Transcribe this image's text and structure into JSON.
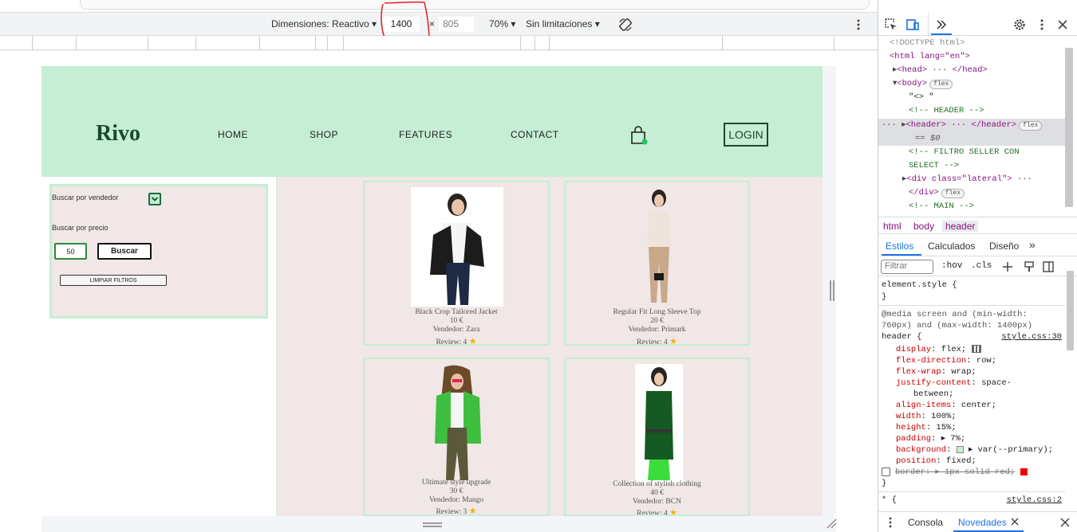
{
  "device_toolbar": {
    "dimensions_label": "Dimensiones: Reactivo ▾",
    "width_value": "1400",
    "times": "×",
    "height_value": "805",
    "zoom_label": "70% ▾",
    "throttle_label": "Sin limitaciones ▾"
  },
  "site": {
    "logo": "Rivo",
    "nav": [
      "HOME",
      "SHOP",
      "FEATURES",
      "CONTACT"
    ],
    "login": "LOGIN",
    "primary_color": "#c5eed4"
  },
  "filters": {
    "seller_label": "Buscar por vendedor",
    "price_label": "Buscar por precio",
    "price_value": "50",
    "search_button": "Buscar",
    "clear_button": "LIMPIAR FILTROS"
  },
  "products": [
    {
      "name": "Black Crop Tailored Jacket",
      "price": "10 €",
      "seller": "Vendedor: Zara",
      "review": "Review: 4"
    },
    {
      "name": "Regular Fit Long Sleeve Top",
      "price": "20 €",
      "seller": "Vendedor: Primark",
      "review": "Review: 4"
    },
    {
      "name": "Ultimate style upgrade",
      "price": "30 €",
      "seller": "Vendedor: Mango",
      "review": "Review: 3"
    },
    {
      "name": "Collection of stylish clothing",
      "price": "40 €",
      "seller": "Vendedor: BCN",
      "review": "Review: 4"
    }
  ],
  "devtools": {
    "dom": {
      "doctype": "<!DOCTYPE html>",
      "html_open": "<html lang=\"en\">",
      "head": "<head> ··· </head>",
      "body_open": "<body>",
      "text_node": "\"<> \"",
      "comment_header": "<!-- HEADER -->",
      "header": "<header> ··· </header>",
      "eq0": "== $0",
      "comment_filter_1": "<!-- FILTRO SELLER  CON",
      "comment_filter_2": "SELECT -->",
      "div_lateral": "<div class=\"lateral\">",
      "div_close": "</div>",
      "comment_main": "<!-- MAIN -->",
      "flex_badge": "flex"
    },
    "breadcrumb": [
      "html",
      "body",
      "header"
    ],
    "tabs": [
      "Estilos",
      "Calculados",
      "Diseño",
      "»"
    ],
    "filter_placeholder": "Filtrar",
    "hov": ":hov",
    "cls": ".cls",
    "css": {
      "element_style": "element.style {",
      "close": "}",
      "media_1": "@media screen and (min-width:",
      "media_2": "760px) and (max-width: 1400px)",
      "selector": "header {",
      "source": "style.css:30",
      "props": [
        {
          "p": "display",
          "v": "flex;"
        },
        {
          "p": "flex-direction",
          "v": "row;"
        },
        {
          "p": "flex-wrap",
          "v": "wrap;"
        },
        {
          "p": "justify-content",
          "v": "space-"
        },
        {
          "p": "",
          "v": "between;"
        },
        {
          "p": "align-items",
          "v": "center;"
        },
        {
          "p": "width",
          "v": "100%;"
        },
        {
          "p": "height",
          "v": "15%;"
        },
        {
          "p": "padding",
          "v": "▸ 7%;"
        },
        {
          "p": "background",
          "v": "▸ var(--primary);"
        },
        {
          "p": "position",
          "v": "fixed;"
        },
        {
          "p": "border",
          "v": "▸ 1px solid red;"
        }
      ],
      "star_selector": "* {",
      "star_source": "style.css:2"
    },
    "drawer": [
      "Consola",
      "Novedades"
    ]
  }
}
